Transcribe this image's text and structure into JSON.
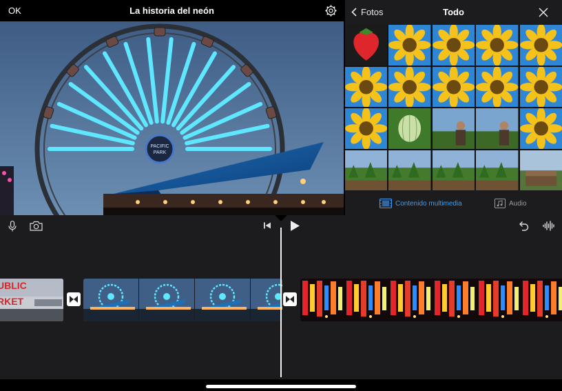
{
  "viewer": {
    "ok_label": "OK",
    "title": "La historia del neón"
  },
  "browser": {
    "back_label": "Fotos",
    "title": "Todo",
    "tabs": [
      {
        "label": "Contenido multimedia",
        "active": true,
        "icon": "film-icon"
      },
      {
        "label": "Audio",
        "active": false,
        "icon": "music-icon"
      }
    ],
    "thumbnails": [
      "strawberry",
      "sunflower",
      "sunflower",
      "sunflower",
      "sunflower",
      "sunflower",
      "sunflower",
      "sunflower",
      "sunflower",
      "sunflower",
      "sunflower",
      "melon",
      "garden-person",
      "garden-person",
      "sunflower",
      "garden",
      "garden",
      "garden",
      "garden",
      "garden-bench"
    ]
  },
  "timeline": {
    "tools": [
      "microphone-icon",
      "camera-icon",
      "skip-to-start-icon",
      "play-icon",
      "undo-icon",
      "waveform-icon"
    ],
    "clips": [
      "market-sign",
      "ferris-wheel",
      "neon-signs"
    ],
    "transitions": [
      "transition-icon",
      "transition-icon"
    ]
  },
  "colors": {
    "accent": "#3d9cf5",
    "timeline_bg": "#1c1c1e",
    "neon_cyan": "#5fe7ff"
  }
}
